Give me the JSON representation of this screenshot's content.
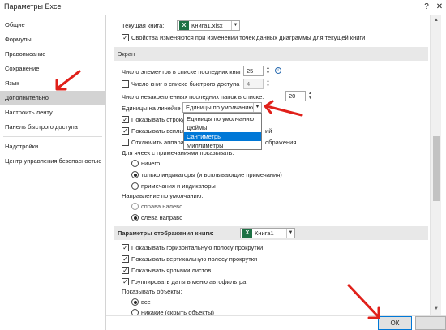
{
  "window": {
    "title": "Параметры Excel",
    "help": "?",
    "close": "✕"
  },
  "sidebar": {
    "items": [
      {
        "label": "Общие"
      },
      {
        "label": "Формулы"
      },
      {
        "label": "Правописание"
      },
      {
        "label": "Сохранение"
      },
      {
        "label": "Язык"
      },
      {
        "label": "Дополнительно",
        "selected": true
      },
      {
        "label": "Настроить ленту"
      },
      {
        "label": "Панель быстрого доступа"
      },
      {
        "label": "Надстройки"
      },
      {
        "label": "Центр управления безопасностью"
      }
    ]
  },
  "top": {
    "current_book_label": "Текущая книга:",
    "current_book_value": "Книга1.xlsx",
    "chart_props_label": "Свойства изменяются при изменении точек данных диаграммы для текущей книги",
    "chart_props_checked": true
  },
  "screen": {
    "header": "Экран",
    "recent_books_label": "Число элементов в списке последних книг:",
    "recent_books_value": "25",
    "quick_access_label": "Число книг в списке быстрого доступа",
    "quick_access_value": "4",
    "quick_access_checked": false,
    "unpinned_folders_label": "Число незакрепленных последних папок в списке:",
    "unpinned_folders_value": "20",
    "ruler_units_label": "Единицы на линейке",
    "ruler_units_value": "Единицы по умолчанию",
    "ruler_units_options": [
      "Единицы по умолчанию",
      "Дюймы",
      "Сантиметры",
      "Миллиметры"
    ],
    "ruler_units_highlighted": "Сантиметры",
    "show_formula_bar_label": "Показывать строку",
    "show_formula_bar_checked": true,
    "show_popup_label": "Показывать всплыв",
    "show_popup_suffix": "ий",
    "show_popup_checked": true,
    "disable_hw_label": "Отключить аппарат",
    "disable_hw_suffix": "ображения",
    "disable_hw_checked": false,
    "comments_label": "Для ячеек с примечаниями показывать:",
    "comments_options": [
      {
        "label": "ничего",
        "selected": false
      },
      {
        "label": "только индикаторы (и всплывающие примечания)",
        "selected": true
      },
      {
        "label": "примечания и индикаторы",
        "selected": false
      }
    ],
    "direction_label": "Направление по умолчанию:",
    "direction_options": [
      {
        "label": "справа налево",
        "selected": false
      },
      {
        "label": "слева направо",
        "selected": true
      }
    ]
  },
  "book_display": {
    "header": "Параметры отображения книги:",
    "book_value": "Книга1",
    "options": [
      {
        "label": "Показывать горизонтальную полосу прокрутки",
        "checked": true
      },
      {
        "label": "Показывать вертикальную полосу прокрутки",
        "checked": true
      },
      {
        "label": "Показывать ярлычки листов",
        "checked": true
      },
      {
        "label": "Группировать даты в меню автофильтра",
        "checked": true
      }
    ],
    "show_objects_label": "Показывать объекты:",
    "objects_options": [
      {
        "label": "все",
        "selected": true
      },
      {
        "label": "никакие (скрыть объекты)",
        "selected": false
      }
    ]
  },
  "footer": {
    "ok_label": "ОК"
  },
  "accent_colors": {
    "selection": "#0078d7",
    "arrow": "#e0201a",
    "excel": "#1e7145"
  },
  "icons": [
    "excel-file-icon",
    "info-icon",
    "chevron-down-icon",
    "close-icon",
    "help-icon",
    "red-arrow-annotation"
  ]
}
